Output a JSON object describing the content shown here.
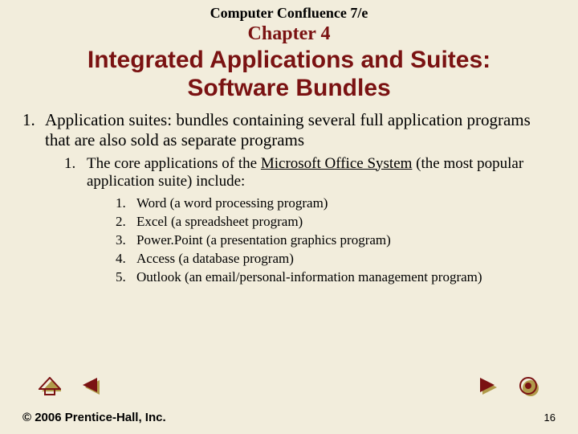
{
  "header": {
    "book_title": "Computer Confluence 7/e",
    "chapter": "Chapter 4",
    "chapter_title_line1": "Integrated Applications and Suites:",
    "chapter_title_line2": "Software Bundles"
  },
  "content": {
    "lvl1_num": "1.",
    "lvl1_text": "Application suites: bundles containing several full application programs that are also sold as separate programs",
    "lvl2_num": "1.",
    "lvl2_pre": "The core applications of the ",
    "lvl2_link": "Microsoft Office System",
    "lvl2_post": " (the most popular application suite) include:",
    "lvl3": [
      {
        "num": "1.",
        "text": "Word (a word processing program)"
      },
      {
        "num": "2.",
        "text": "Excel (a spreadsheet program)"
      },
      {
        "num": "3.",
        "text": "Power.Point (a presentation graphics program)"
      },
      {
        "num": "4.",
        "text": "Access (a database program)"
      },
      {
        "num": "5.",
        "text": "Outlook (an email/personal-information management program)"
      }
    ]
  },
  "footer": {
    "copyright": "© 2006 Prentice-Hall, Inc.",
    "page": "16"
  },
  "colors": {
    "heading": "#7a1212",
    "nav_fill": "#7a1212",
    "nav_shadow": "#b09a4a"
  }
}
